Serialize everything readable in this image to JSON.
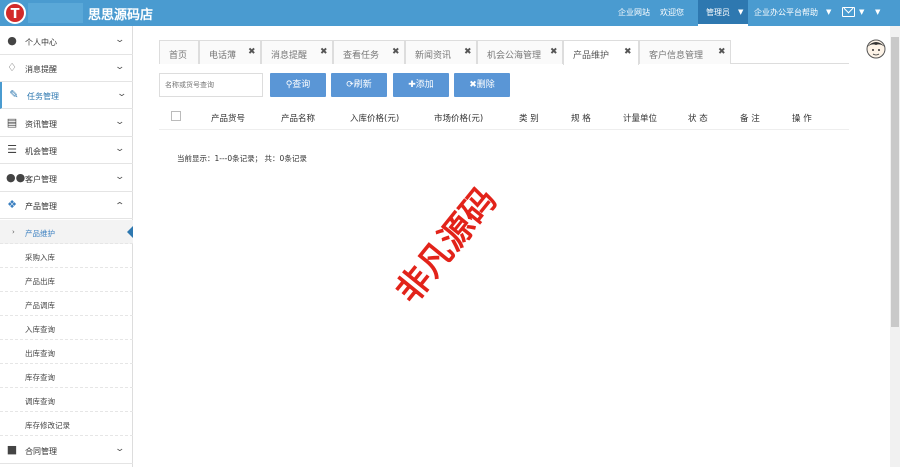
{
  "header": {
    "brand": "思思源码店",
    "logo_letter": "T",
    "links": [
      "企业网站",
      "欢迎您",
      "管理员",
      "企业办公平台帮助"
    ],
    "accent": "#4a9bd0"
  },
  "sidebar": {
    "items": [
      {
        "label": "个人中心",
        "icon": "user-icon"
      },
      {
        "label": "消息提醒",
        "icon": "bell-icon"
      },
      {
        "label": "任务管理",
        "icon": "edit-icon"
      },
      {
        "label": "资讯管理",
        "icon": "document-icon"
      },
      {
        "label": "机会管理",
        "icon": "list-icon"
      },
      {
        "label": "客户管理",
        "icon": "users-icon"
      },
      {
        "label": "产品管理",
        "icon": "dropbox-icon"
      }
    ],
    "sub_items": [
      "产品维护",
      "采购入库",
      "产品出库",
      "产品调库",
      "入库查询",
      "出库查询",
      "库存查询",
      "调库查询",
      "库存修改记录"
    ],
    "bottom_item": {
      "label": "合同管理",
      "icon": "folder-icon"
    }
  },
  "tabs": [
    {
      "label": "首页",
      "closable": false
    },
    {
      "label": "电话薄",
      "closable": true
    },
    {
      "label": "消息提醒",
      "closable": true
    },
    {
      "label": "查看任务",
      "closable": true
    },
    {
      "label": "新闻资讯",
      "closable": true
    },
    {
      "label": "机会公海管理",
      "closable": true
    },
    {
      "label": "产品维护",
      "closable": true
    },
    {
      "label": "客户信息管理",
      "closable": true
    }
  ],
  "toolbar": {
    "search_placeholder": "名称或货号查询",
    "query": "查询",
    "refresh": "刷新",
    "add": "添加",
    "delete": "删除",
    "button_color": "#5a96d6"
  },
  "table": {
    "columns": [
      "产品货号",
      "产品名称",
      "入库价格(元)",
      "市场价格(元)",
      "类 别",
      "规 格",
      "计量单位",
      "状 态",
      "备 注",
      "操 作"
    ],
    "rows": []
  },
  "pager": {
    "text": "当前显示：1---0条记录； 共：0条记录"
  },
  "watermark": "非凡源码"
}
